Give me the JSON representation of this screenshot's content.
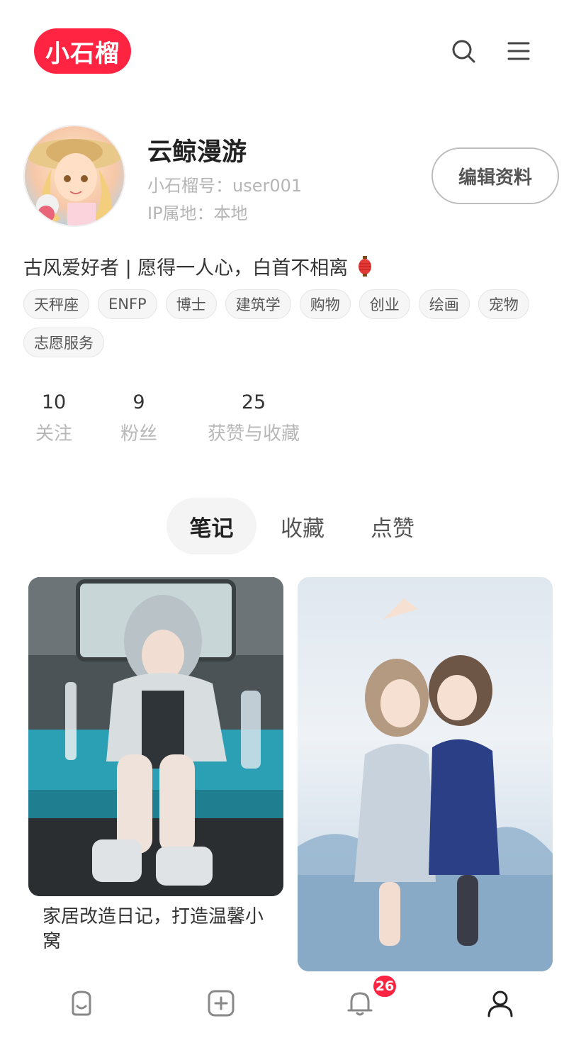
{
  "header": {
    "logo_text": "小石榴",
    "brand_color": "#ff2442",
    "icons": [
      "search-icon",
      "menu-icon"
    ]
  },
  "profile": {
    "name": "云鲸漫游",
    "id_line": "小石榴号：user001",
    "ip_line": "IP属地：本地",
    "edit_label": "编辑资料",
    "bio": "古风爱好者 | 愿得一人心，白首不相离",
    "tags": [
      "天秤座",
      "ENFP",
      "博士",
      "建筑学",
      "购物",
      "创业",
      "绘画",
      "宠物",
      "志愿服务"
    ]
  },
  "stats": [
    {
      "value": "10",
      "label": "关注"
    },
    {
      "value": "9",
      "label": "粉丝"
    },
    {
      "value": "25",
      "label": "获赞与收藏"
    }
  ],
  "tabs": [
    {
      "label": "笔记",
      "active": true
    },
    {
      "label": "收藏",
      "active": false
    },
    {
      "label": "点赞",
      "active": false
    }
  ],
  "notes": [
    {
      "title": "家居改造日记，打造温馨小窝"
    },
    {
      "title": ""
    }
  ],
  "bottom_nav": {
    "items": [
      "home-icon",
      "add-icon",
      "bell-icon",
      "profile-icon"
    ],
    "notification_count": "26"
  }
}
